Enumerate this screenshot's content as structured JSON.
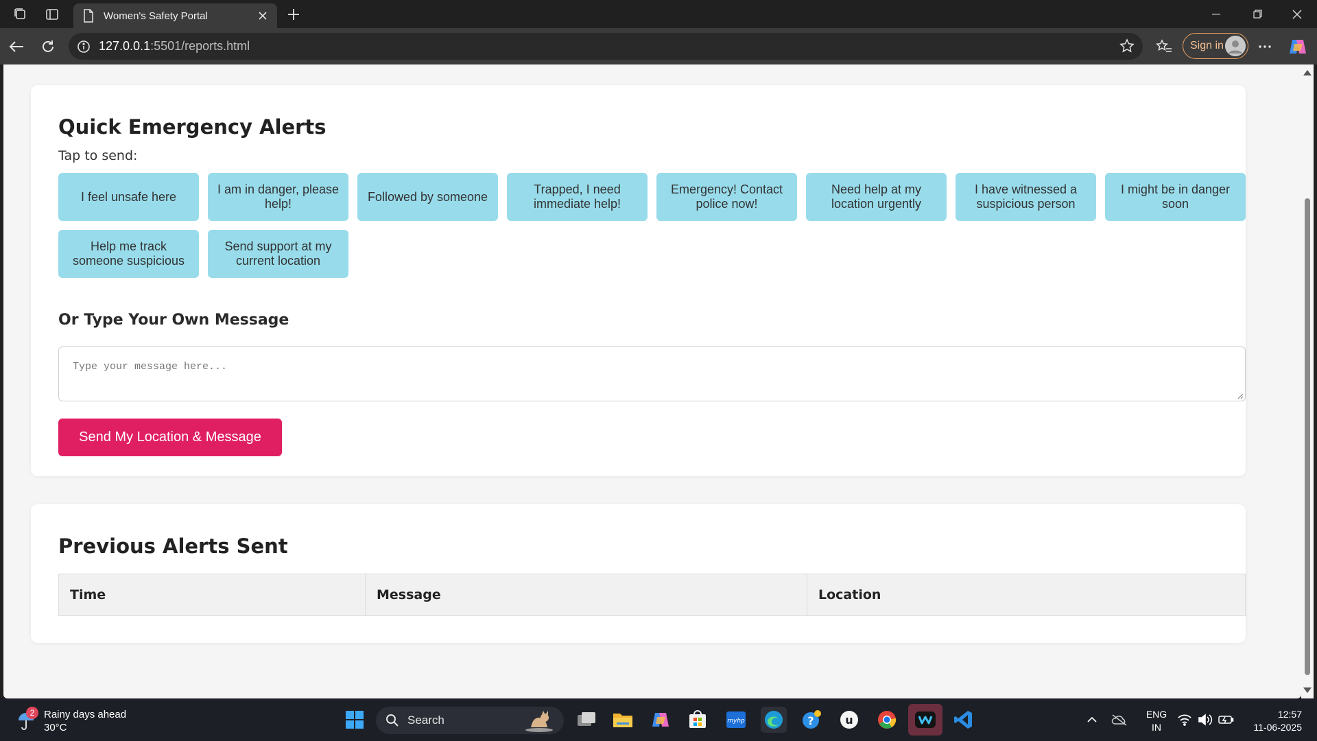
{
  "browser": {
    "tab_title": "Women's Safety Portal",
    "url_host": "127.0.0.1",
    "url_path": ":5501/reports.html",
    "signin_label": "Sign in"
  },
  "page": {
    "quick_alerts": {
      "title": "Quick Emergency Alerts",
      "subtitle": "Tap to send:",
      "buttons": [
        "I feel unsafe here",
        "I am in danger, please help!",
        "Followed by someone",
        "Trapped, I need immediate help!",
        "Emergency! Contact police now!",
        "Need help at my location urgently",
        "I have witnessed a suspicious person",
        "I might be in danger soon",
        "Help me track someone suspicious",
        "Send support at my current location"
      ]
    },
    "custom_message": {
      "title": "Or Type Your Own Message",
      "placeholder": "Type your message here...",
      "send_label": "Send My Location & Message"
    },
    "previous_alerts": {
      "title": "Previous Alerts Sent",
      "columns": [
        "Time",
        "Message",
        "Location"
      ]
    }
  },
  "taskbar": {
    "weather_badge": "2",
    "weather_title": "Rainy days ahead",
    "weather_temp": "30°C",
    "search_label": "Search",
    "lang_line1": "ENG",
    "lang_line2": "IN",
    "time": "12:57",
    "date": "11-06-2025"
  },
  "colors": {
    "alert_button_bg": "#98dceb",
    "send_button_bg": "#e01f62",
    "page_bg": "#f5f5f5"
  }
}
